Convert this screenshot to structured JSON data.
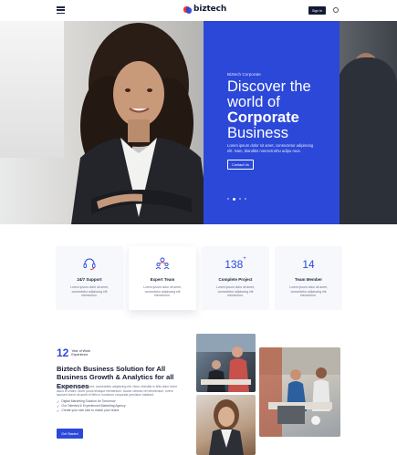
{
  "header": {
    "brand": "biztech",
    "signin_label": "Sign In",
    "icons": {
      "menu": "hamburger-icon",
      "language": "globe-icon",
      "logo": "biztech-logo"
    }
  },
  "hero": {
    "eyebrow": "Biztech Corporate",
    "title_line1": "Discover the",
    "title_line2": "world of",
    "title_bold": "Corporate",
    "title_line4": "Business",
    "description": "Lorem ipsum dolor sit amet, consectetur adipiscing elit. Nam, blanditis nonrectruthu adipu rous.",
    "cta_label": "Contact Us",
    "panel_color": "#2c48d8",
    "slides": 4,
    "active_slide": 2
  },
  "features": [
    {
      "icon": "headset-icon",
      "title": "24/7 Support",
      "desc": "Lorem ipsum dolor sit amet, consectetur adipiscing elit elementum."
    },
    {
      "icon": "team-icon",
      "title": "Expert Team",
      "desc": "Lorem ipsum dolor sit amet, consectetur adipiscing elit elementum."
    },
    {
      "number": "138",
      "suffix": "+",
      "title": "Complete Project",
      "desc": "Lorem ipsum dolor sit amet, consectetur adipiscing elit elementum."
    },
    {
      "number": "14",
      "title": "Team Member",
      "desc": "Lorem ipsum dolor sit amet, consectetur adipiscing elit elementum."
    }
  ],
  "business": {
    "years_number": "12",
    "years_label": "Year of Work Experience",
    "title": "Biztech Business Solution for All Business Growth & Analytics for all Expenses",
    "description": "Lorem ipsum dolor sit amet, consectetur adipiscing elit. Nam, blandits in felis dolor tortor lacus a ornare. Morb purus tristique elementum. Auctor ultrices vel elementum, lorem lacused dorce sit amet et felis in nominum corporate precision habitant.",
    "list": [
      "Digital Marketing Solution for Tomorrow",
      "Our Talented & Experienced Marketing Agency",
      "Create your own skin to match your brand"
    ],
    "cta_label": "Get Started",
    "accent": "#2c48d8"
  }
}
